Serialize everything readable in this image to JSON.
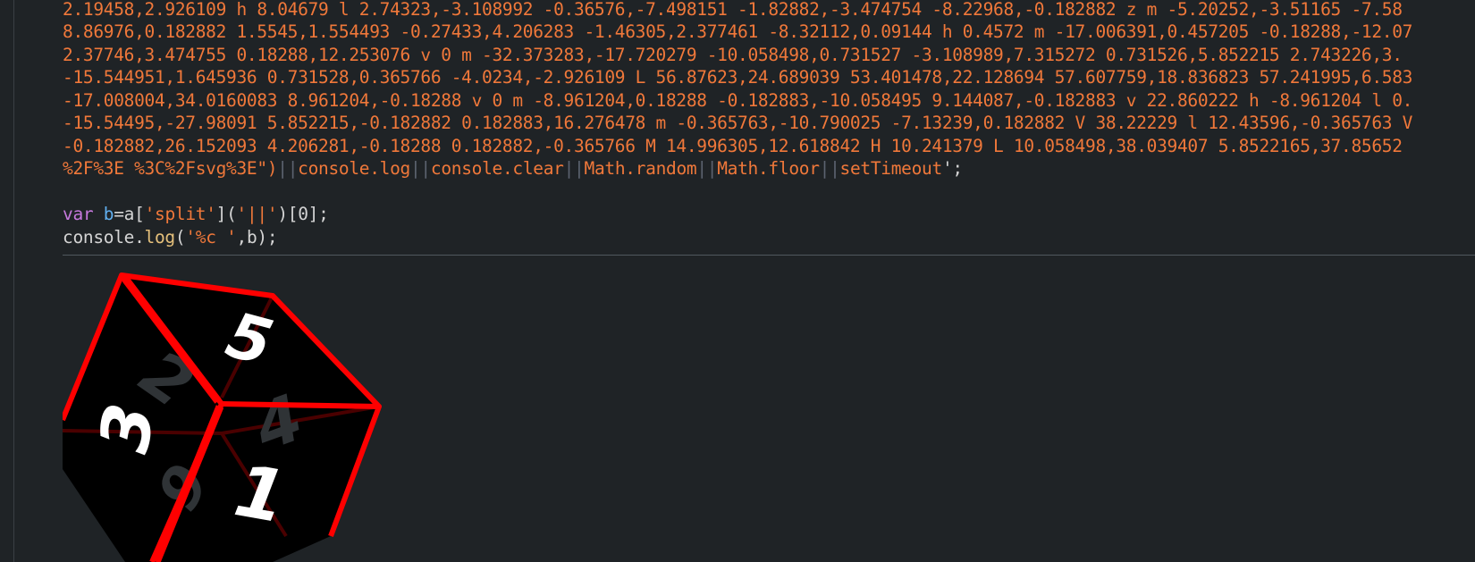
{
  "code": {
    "string_lines": [
      "2.19458,2.926109 h 8.04679 l 2.74323,-3.108992 -0.36576,-7.498151 -1.82882,-3.474754 -8.22968,-0.182882 z m -5.20252,-3.51165 -7.58",
      "8.86976,0.182882 1.5545,1.554493 -0.27433,4.206283 -1.46305,2.377461 -8.32112,0.09144 h 0.4572 m -17.006391,0.457205 -0.18288,-12.07",
      "2.37746,3.474755 0.18288,12.253076 v 0 m -32.373283,-17.720279 -10.058498,0.731527 -3.108989,7.315272 0.731526,5.852215 2.743226,3.",
      "-15.544951,1.645936 0.731528,0.365766 -4.0234,-2.926109 L 56.87623,24.689039 53.401478,22.128694 57.607759,18.836823 57.241995,6.583",
      "-17.008004,34.0160083 8.961204,-0.18288 v 0 m -8.961204,0.18288 -0.182883,-10.058495 9.144087,-0.182883 v 22.860222 h -8.961204 l 0.",
      "-15.54495,-27.98091 5.852215,-0.182882 0.182883,16.276478 m -0.365763,-10.790025 -7.13239,0.182882 V 38.22229 l 12.43596,-0.365763 V",
      "-0.182882,26.152093 4.206281,-0.18288 0.182882,-0.365766 M 14.996305,12.618842 H 10.241379 L 10.058498,38.039407 5.8522165,37.85652"
    ],
    "tail_line": {
      "string_end": "%2F%3E %3C%2Fsvg%3E\")",
      "separator": "||",
      "items": [
        "console.log",
        "console.clear",
        "Math.random",
        "Math.floor",
        "setTimeout"
      ],
      "end": "';"
    },
    "line_var": {
      "keyword": "var",
      "name": "b",
      "eq": "=a[",
      "arg1": "'split'",
      "mid": "](",
      "arg2": "'||'",
      "end": ")[0];"
    },
    "line_log": {
      "obj": "console.",
      "method": "log",
      "open": "(",
      "arg1": "'%c '",
      "end": ",b);"
    }
  },
  "console_output": {
    "dice_faces": [
      "5",
      "3",
      "1",
      "2",
      "4",
      "6"
    ]
  },
  "colors": {
    "background": "#1f2326",
    "string": "#f0783a",
    "keyword": "#c678dd",
    "variable": "#61afef",
    "function": "#e5c07b",
    "plain": "#d4d4d4",
    "dice_edge": "#ff0000",
    "dice_face": "#000000"
  }
}
